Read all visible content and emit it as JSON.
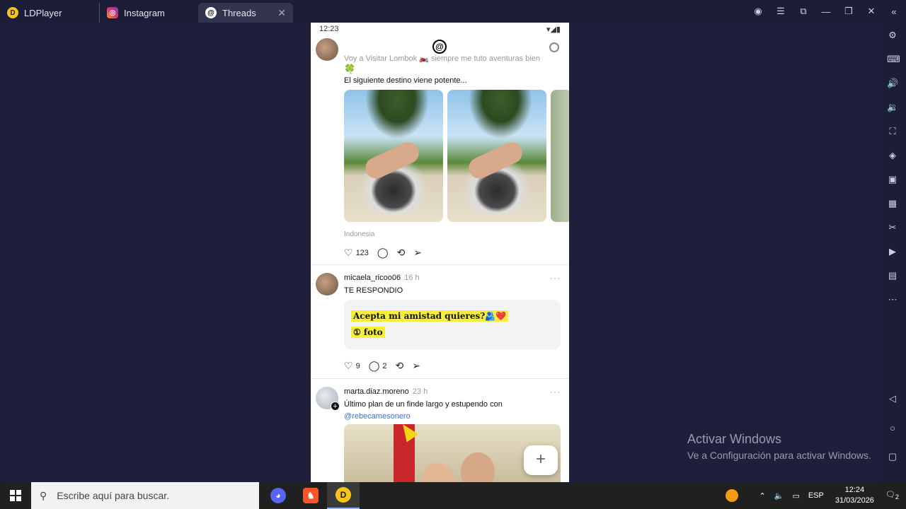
{
  "tabs": [
    {
      "label": "LDPlayer",
      "icon": "ldplayer-icon"
    },
    {
      "label": "Instagram",
      "icon": "instagram-icon"
    },
    {
      "label": "Threads",
      "icon": "threads-icon"
    }
  ],
  "phone": {
    "status_time": "12:23",
    "post1": {
      "cut_text": "Voy a Visitar Lombok 🏍️ siempre me tuto aventuras bien",
      "caption": "El siguiente destino viene potente...",
      "location": "Indonesia",
      "likes": "123"
    },
    "post2": {
      "username": "micaela_ricoo06",
      "time": "16 h",
      "text": "TE RESPONDIO",
      "quote_line1": "Acepta mi amistad quieres?🫂❤️",
      "quote_line2": "① foto",
      "likes": "9",
      "replies": "2"
    },
    "post3": {
      "username": "marta.diaz.moreno",
      "time": "23 h",
      "text": "Último plan de un finde largo y estupendo  con",
      "mention": "@rebecamesonero"
    }
  },
  "watermark": {
    "title": "Activar Windows",
    "subtitle": "Ve a Configuración para activar Windows."
  },
  "taskbar": {
    "search_placeholder": "Escribe aquí para buscar.",
    "language": "ESP",
    "time": "12:24",
    "date": "31/03/2026",
    "notifications": "2"
  }
}
